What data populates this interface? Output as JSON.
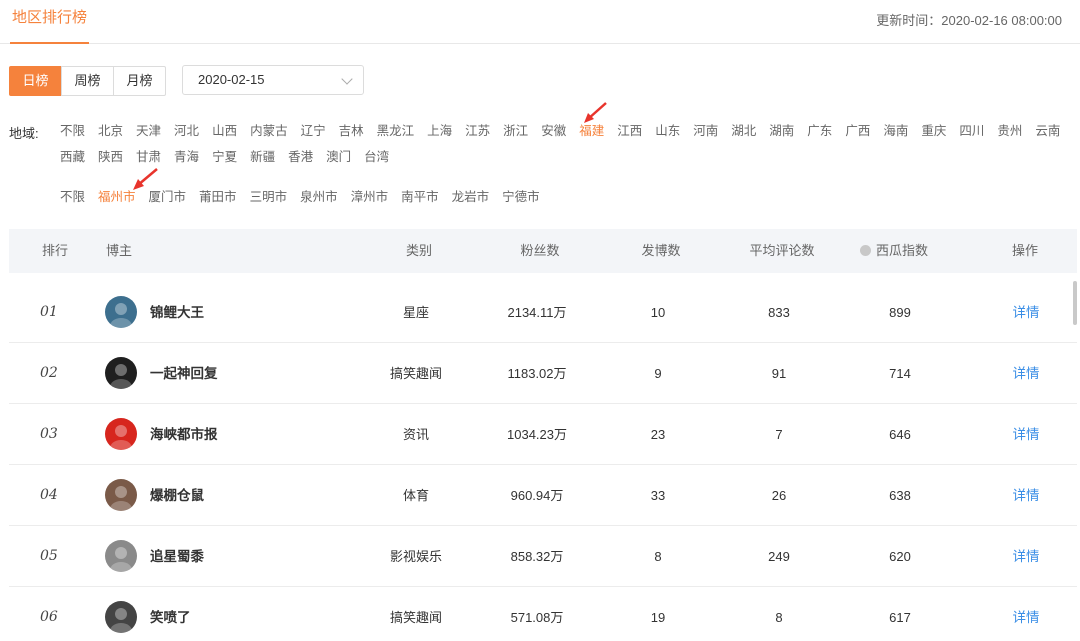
{
  "header": {
    "tab_label": "地区排行榜",
    "update_time": "更新时间：2020-02-16 08:00:00"
  },
  "filters": {
    "periods": [
      "日榜",
      "周榜",
      "月榜"
    ],
    "active_period": "日榜",
    "date_value": "2020-02-15",
    "region_label": "地域:",
    "provinces_row1": [
      "不限",
      "北京",
      "天津",
      "河北",
      "山西",
      "内蒙古",
      "辽宁",
      "吉林",
      "黑龙江",
      "上海",
      "江苏",
      "浙江",
      "安徽",
      "福建",
      "江西",
      "山东",
      "河南",
      "湖北",
      "湖南",
      "广东",
      "广西",
      "海南",
      "重庆",
      "四川",
      "贵州",
      "云南"
    ],
    "provinces_row2": [
      "西藏",
      "陕西",
      "甘肃",
      "青海",
      "宁夏",
      "新疆",
      "香港",
      "澳门",
      "台湾"
    ],
    "active_province": "福建",
    "cities": [
      "不限",
      "福州市",
      "厦门市",
      "莆田市",
      "三明市",
      "泉州市",
      "漳州市",
      "南平市",
      "龙岩市",
      "宁德市"
    ],
    "active_city": "福州市"
  },
  "table": {
    "headers": {
      "rank": "排行",
      "blogger": "博主",
      "category": "类别",
      "fans": "粉丝数",
      "posts": "发博数",
      "avg_comments": "平均评论数",
      "xigua_index": "西瓜指数",
      "action": "操作"
    },
    "rows": [
      {
        "rank": "01",
        "name": "锦鲤大王",
        "category": "星座",
        "fans": "2134.11万",
        "posts": "10",
        "avg_comments": "833",
        "index": "899",
        "action": "详情",
        "avatar_color": "#3d6f8e"
      },
      {
        "rank": "02",
        "name": "一起神回复",
        "category": "搞笑趣闻",
        "fans": "1183.02万",
        "posts": "9",
        "avg_comments": "91",
        "index": "714",
        "action": "详情",
        "avatar_color": "#1f1f1f"
      },
      {
        "rank": "03",
        "name": "海峡都市报",
        "category": "资讯",
        "fans": "1034.23万",
        "posts": "23",
        "avg_comments": "7",
        "index": "646",
        "action": "详情",
        "avatar_color": "#d7261e"
      },
      {
        "rank": "04",
        "name": "爆棚仓鼠",
        "category": "体育",
        "fans": "960.94万",
        "posts": "33",
        "avg_comments": "26",
        "index": "638",
        "action": "详情",
        "avatar_color": "#7a5a48"
      },
      {
        "rank": "05",
        "name": "追星蜀黍",
        "category": "影视娱乐",
        "fans": "858.32万",
        "posts": "8",
        "avg_comments": "249",
        "index": "620",
        "action": "详情",
        "avatar_color": "#8a8a8a"
      },
      {
        "rank": "06",
        "name": "笑喷了",
        "category": "搞笑趣闻",
        "fans": "571.08万",
        "posts": "19",
        "avg_comments": "8",
        "index": "617",
        "action": "详情",
        "avatar_color": "#444444"
      }
    ]
  },
  "colors": {
    "accent": "#f5823c",
    "link": "#3a8ee6",
    "arrow": "#e8342c"
  }
}
